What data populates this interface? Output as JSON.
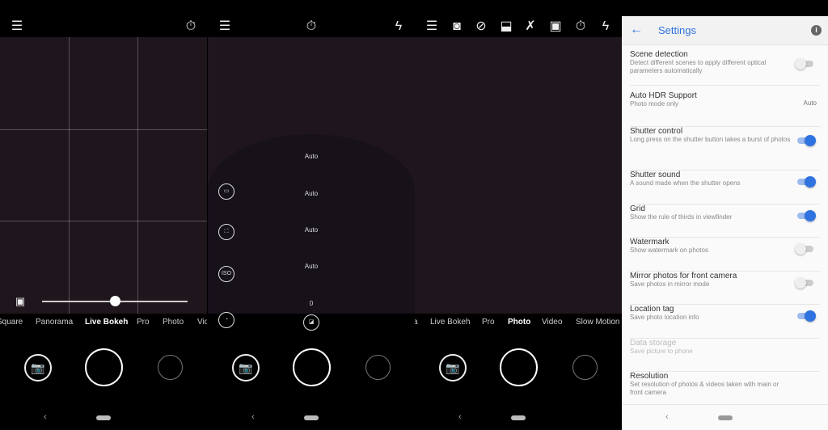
{
  "panel1": {
    "modes": [
      "Square",
      "Panorama",
      "Live Bokeh",
      "Pro",
      "Photo",
      "Vid"
    ],
    "selected_mode": "Live Bokeh",
    "bokeh_level_percent": 50
  },
  "panel2": {
    "values": [
      "Auto",
      "Auto",
      "Auto",
      "Auto",
      "0"
    ],
    "icons": [
      "white-balance-icon",
      "focus-icon",
      "iso-icon",
      "shutter-speed-icon",
      "exposure-icon"
    ],
    "iso_label": "ISO"
  },
  "panel3": {
    "modes": [
      "a",
      "Live Bokeh",
      "Pro",
      "Photo",
      "Video",
      "Slow Motion"
    ],
    "selected_mode": "Photo"
  },
  "settings": {
    "title": "Settings",
    "accent": "#2f73e0",
    "items": [
      {
        "title": "Scene detection",
        "subtitle": "Detect different scenes to apply different optical parameters automatically",
        "toggle": false
      },
      {
        "title": "Auto HDR Support",
        "subtitle": "Photo mode only",
        "value": "Auto"
      },
      {
        "title": "Shutter control",
        "subtitle": "Long press on the shutter button takes a burst of photos",
        "toggle": true
      },
      {
        "title": "Shutter sound",
        "subtitle": "A sound made when the shutter opens",
        "toggle": true
      },
      {
        "title": "Grid",
        "subtitle": "Show the rule of thirds in viewfinder",
        "toggle": true
      },
      {
        "title": "Watermark",
        "subtitle": "Show watermark on photos",
        "toggle": false
      },
      {
        "title": "Mirror photos for front camera",
        "subtitle": "Save photos in mirror mode",
        "toggle": false
      },
      {
        "title": "Location tag",
        "subtitle": "Save photo location info",
        "toggle": true
      },
      {
        "title": "Data storage",
        "subtitle": "Save picture to phone",
        "disabled": true
      },
      {
        "title": "Resolution",
        "subtitle": "Set resolution of photos & videos taken with main or front camera"
      }
    ]
  }
}
